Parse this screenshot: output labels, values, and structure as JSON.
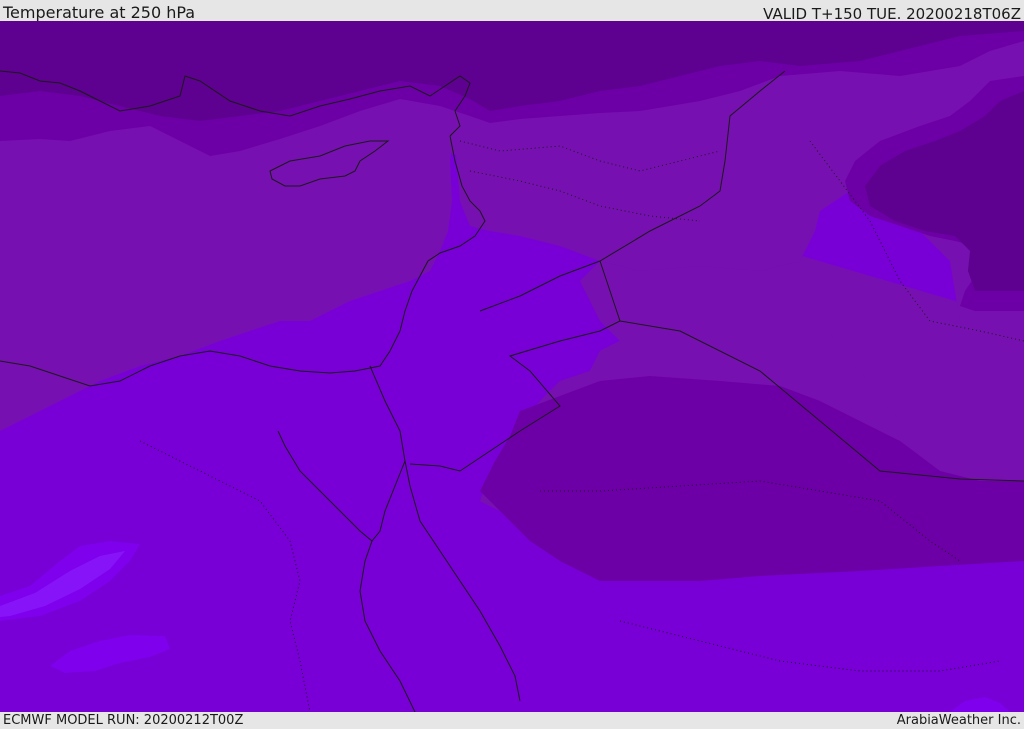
{
  "header": {
    "title": "Temperature at 250 hPa",
    "valid_time": "VALID T+150 TUE. 20200218T06Z"
  },
  "footer": {
    "model_run": "ECMWF MODEL RUN: 20200212T00Z",
    "brand": "ArabiaWeather Inc."
  },
  "map": {
    "region": "Eastern Mediterranean and Middle East",
    "field": "temperature",
    "level_hpa": 250,
    "shading_colors": {
      "coldest": "#5e0090",
      "colder": "#6c00a6",
      "cold": "#7710b0",
      "base": "#7800d6",
      "warmer": "#7f00ec",
      "warmest": "#8a1cff"
    }
  }
}
